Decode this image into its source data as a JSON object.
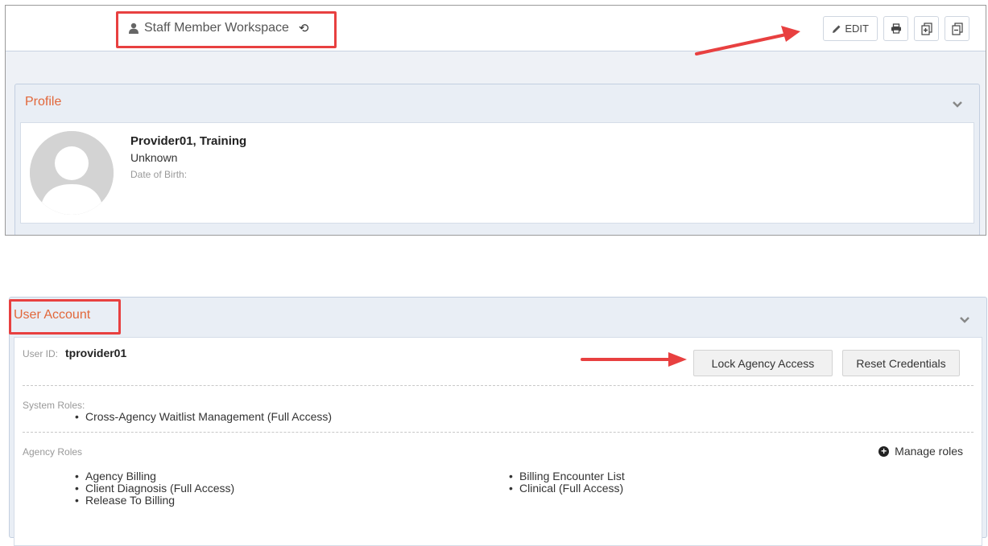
{
  "header": {
    "title": "Staff Member Workspace",
    "toolbar": {
      "edit_label": "EDIT"
    }
  },
  "profile": {
    "panel_title": "Profile",
    "name": "Provider01, Training",
    "status": "Unknown",
    "dob_label": "Date of Birth:"
  },
  "user_account": {
    "panel_title": "User Account",
    "user_id_label": "User ID:",
    "user_id_value": "tprovider01",
    "lock_button": "Lock Agency Access",
    "reset_button": "Reset Credentials",
    "system_roles_label": "System Roles:",
    "system_roles": [
      "Cross-Agency Waitlist Management (Full Access)"
    ],
    "agency_roles_label": "Agency Roles",
    "manage_roles_label": "Manage roles",
    "agency_roles_left": [
      "Agency Billing",
      "Client Diagnosis (Full Access)",
      "Release To Billing"
    ],
    "agency_roles_right": [
      "Billing Encounter List",
      "Clinical (Full Access)"
    ]
  },
  "colors": {
    "accent": "#e2673a",
    "highlight": "#e84040",
    "panel_bg": "#e9eef5"
  },
  "icons": [
    "user-icon",
    "history-icon",
    "pencil-icon",
    "print-icon",
    "expand-all-icon",
    "collapse-all-icon",
    "chevron-down-icon",
    "plus-circle-icon",
    "avatar-placeholder-icon"
  ]
}
